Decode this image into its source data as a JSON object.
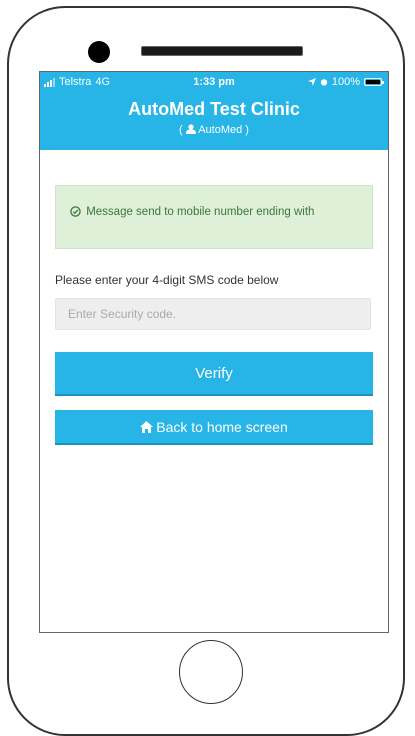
{
  "status_bar": {
    "carrier": "Telstra",
    "network": "4G",
    "time": "1:33 pm",
    "battery": "100%",
    "icons": [
      "signal-icon",
      "location-arrow-icon",
      "alarm-icon",
      "battery-icon"
    ]
  },
  "header": {
    "title": "AutoMed Test Clinic",
    "subtitle_open": "(",
    "subtitle_user": "AutoMed",
    "subtitle_close": ")",
    "background_color": "#26b5e6"
  },
  "alert": {
    "icon": "check-circle-icon",
    "message": "Message send to mobile number ending with",
    "background_color": "#dff0d8",
    "text_color": "#3c763d"
  },
  "form": {
    "prompt": "Please enter your 4-digit SMS code below",
    "code_placeholder": "Enter Security code.",
    "code_value": "",
    "verify_label": "Verify",
    "home_icon": "home-icon",
    "back_label": "Back to home screen"
  }
}
